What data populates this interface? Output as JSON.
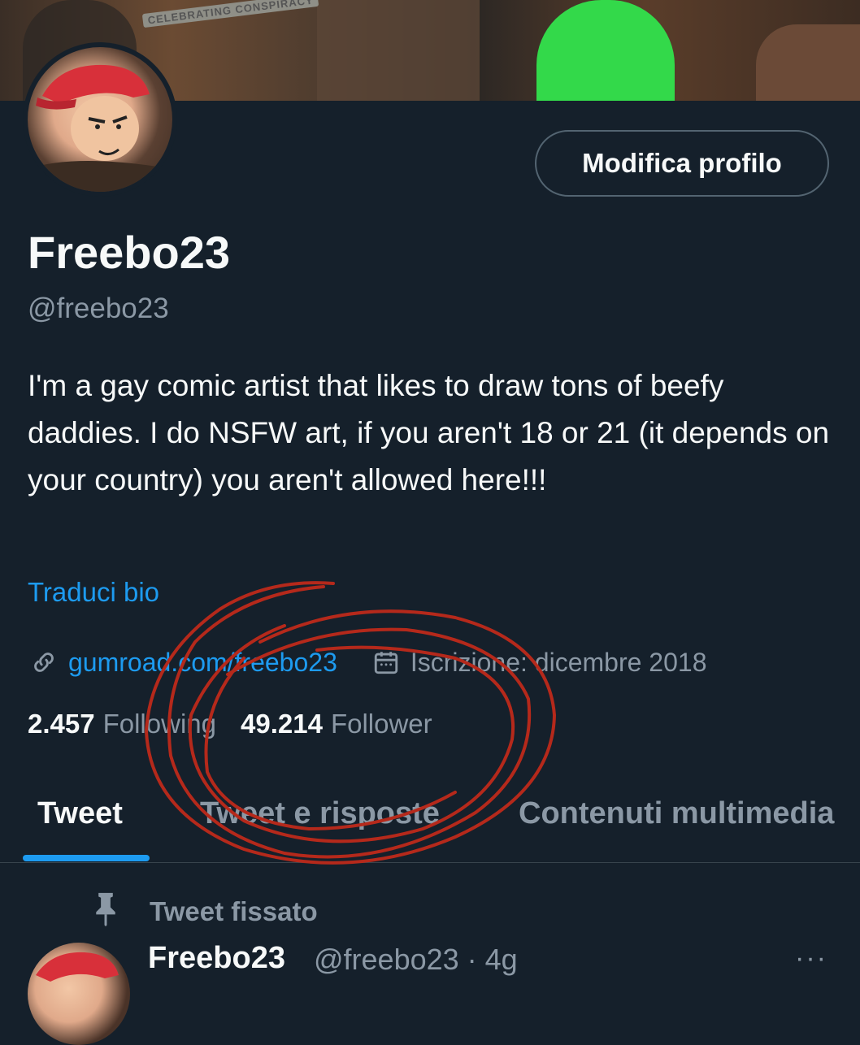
{
  "banner": {
    "stamp_text": "CELEBRATING CONSPIRACY"
  },
  "profile": {
    "edit_button": "Modifica profilo",
    "display_name": "Freebo23",
    "handle": "@freebo23",
    "bio": "I'm a gay comic artist that likes to draw tons of beefy daddies. I do NSFW art, if you aren't 18 or 21 (it depends on your country) you aren't allowed here!!!",
    "translate_bio": "Traduci bio",
    "website": "gumroad.com/freebo23",
    "joined": "Iscrizione: dicembre 2018"
  },
  "stats": {
    "following_count": "2.457",
    "following_label": "Following",
    "followers_count": "49.214",
    "followers_label": "Follower"
  },
  "tabs": [
    {
      "label": "Tweet",
      "active": true
    },
    {
      "label": "Tweet e risposte",
      "active": false
    },
    {
      "label": "Contenuti multimedia",
      "active": false
    }
  ],
  "pinned": {
    "label": "Tweet fissato",
    "icon": "pin-icon"
  },
  "tweet": {
    "name": "Freebo23",
    "handle_time": "@freebo23 · 4g",
    "more": "···"
  },
  "icons": {
    "link": "link-icon",
    "calendar": "calendar-icon"
  },
  "colors": {
    "background": "#15202b",
    "accent": "#1d9bf0",
    "muted": "#8b98a5",
    "annotation": "#b5291b"
  }
}
